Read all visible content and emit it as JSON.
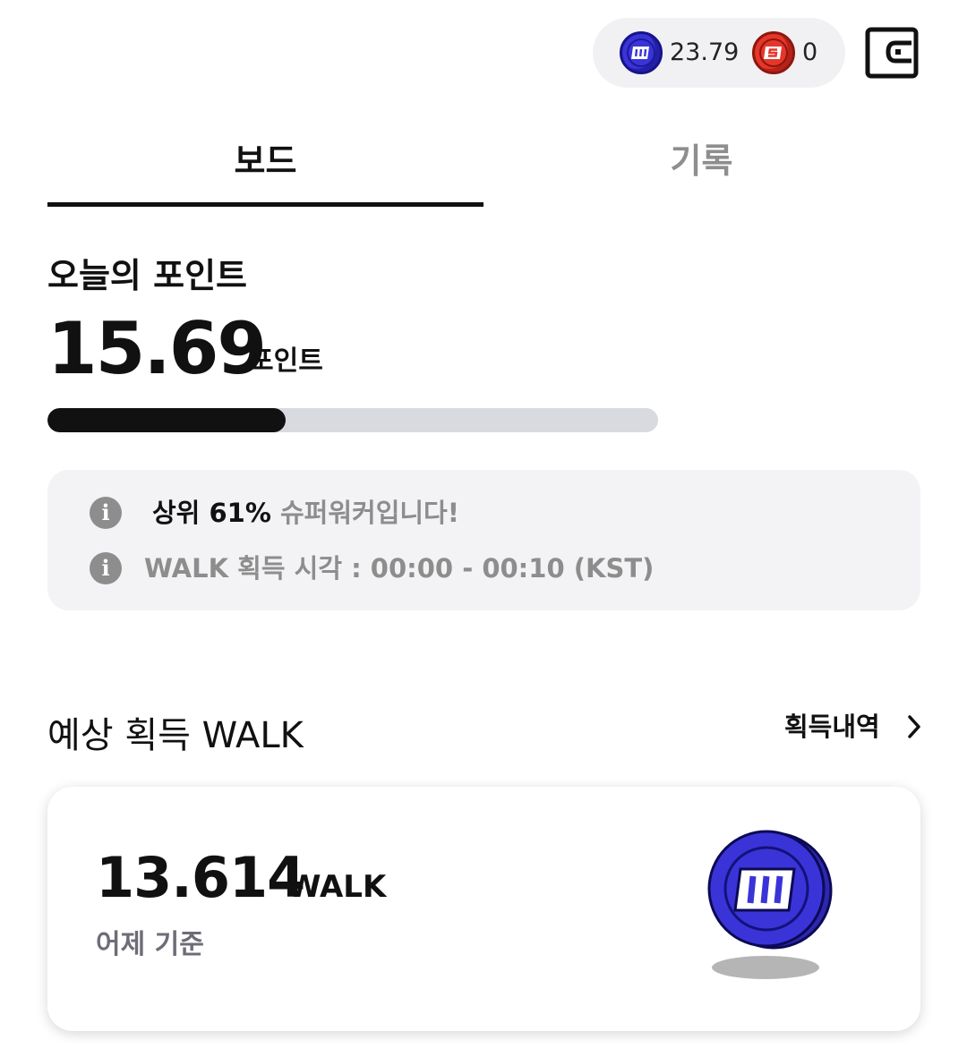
{
  "header": {
    "walk_coin_icon": "walk-coin-icon",
    "walk_balance": "23.79",
    "super_coin_icon": "super-coin-icon",
    "super_balance": "0",
    "wallet_icon": "wallet-icon"
  },
  "tabs": [
    {
      "label": "보드",
      "active": true
    },
    {
      "label": "기록",
      "active": false
    }
  ],
  "today": {
    "title": "오늘의 포인트",
    "value": "15.69",
    "unit": "포인트",
    "progress_fraction": 0.39
  },
  "info": {
    "rank_prefix": "상위 61%",
    "rank_suffix": " 슈퍼워커입니다!",
    "time_text": "WALK 획득 시각 : 00:00 - 00:10 (KST)"
  },
  "expected": {
    "title": "예상 획득 WALK",
    "history_link": "획득내역",
    "amount": "13.614",
    "unit": "WALK",
    "basis": "어제 기준"
  },
  "colors": {
    "walk_coin": "#3a34d8",
    "super_coin": "#e6362a",
    "progress_fill": "#111111",
    "progress_track": "#d8dae0",
    "info_bg": "#f3f3f5",
    "muted_text": "#8d8d8d"
  }
}
